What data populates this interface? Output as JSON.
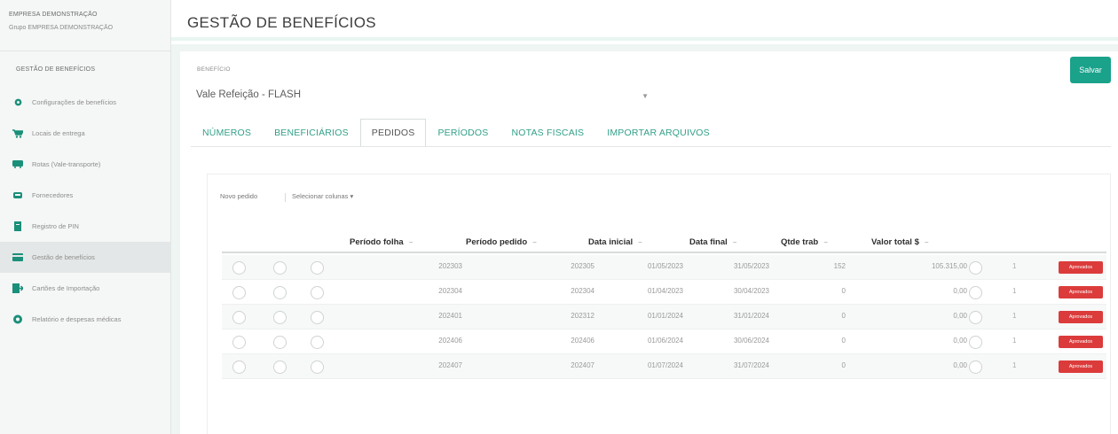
{
  "sidebar": {
    "company": "EMPRESA DEMONSTRAÇÃO",
    "group": "Grupo EMPRESA DEMONSTRAÇÃO",
    "section": "GESTÃO DE BENEFÍCIOS",
    "items": [
      {
        "label": "Configurações de benefícios",
        "icon": "gear-icon",
        "color": "#1a8f79"
      },
      {
        "label": "Locais de entrega",
        "icon": "cart-icon",
        "color": "#1a8f79"
      },
      {
        "label": "Rotas (Vale-transporte)",
        "icon": "bus-icon",
        "color": "#1a8f79"
      },
      {
        "label": "Fornecedores",
        "icon": "car-icon",
        "color": "#1a8f79"
      },
      {
        "label": "Registro de PIN",
        "icon": "document-icon",
        "color": "#1a8f79"
      },
      {
        "label": "Gestão de benefícios",
        "icon": "card-icon",
        "color": "#1a8f79"
      },
      {
        "label": "Cartões de Importação",
        "icon": "file-import-icon",
        "color": "#1a8f79"
      },
      {
        "label": "Relatório e despesas médicas",
        "icon": "stethoscope-icon",
        "color": "#1a8f79"
      }
    ],
    "active_index": 5
  },
  "header": {
    "title": "GESTÃO DE BENEFÍCIOS"
  },
  "form": {
    "benefit_label": "BENEFÍCIO",
    "benefit_value": "Vale Refeição - FLASH",
    "save_label": "Salvar"
  },
  "tabs": [
    {
      "label": "NÚMEROS",
      "active": false
    },
    {
      "label": "BENEFICIÁRIOS",
      "active": false
    },
    {
      "label": "PEDIDOS",
      "active": true
    },
    {
      "label": "PERÍODOS",
      "active": false
    },
    {
      "label": "NOTAS FISCAIS",
      "active": false
    },
    {
      "label": "IMPORTAR ARQUIVOS",
      "active": false
    }
  ],
  "toolbar": {
    "new_order": "Novo pedido",
    "select_columns": "Selecionar colunas"
  },
  "table": {
    "columns": [
      "Período folha",
      "Período pedido",
      "Data inicial",
      "Data final",
      "Qtde trab",
      "Valor total $"
    ],
    "rows": [
      {
        "periodo_folha": "202303",
        "periodo_pedido": "202305",
        "data_inicial": "01/05/2023",
        "data_final": "31/05/2023",
        "qtde_trab": "152",
        "valor_total": "105.315,00",
        "pin": "1",
        "status": "Aprovados"
      },
      {
        "periodo_folha": "202304",
        "periodo_pedido": "202304",
        "data_inicial": "01/04/2023",
        "data_final": "30/04/2023",
        "qtde_trab": "0",
        "valor_total": "0,00",
        "pin": "1",
        "status": "Aprovados"
      },
      {
        "periodo_folha": "202401",
        "periodo_pedido": "202312",
        "data_inicial": "01/01/2024",
        "data_final": "31/01/2024",
        "qtde_trab": "0",
        "valor_total": "0,00",
        "pin": "1",
        "status": "Aprovados"
      },
      {
        "periodo_folha": "202406",
        "periodo_pedido": "202406",
        "data_inicial": "01/06/2024",
        "data_final": "30/06/2024",
        "qtde_trab": "0",
        "valor_total": "0,00",
        "pin": "1",
        "status": "Aprovados"
      },
      {
        "periodo_folha": "202407",
        "periodo_pedido": "202407",
        "data_inicial": "01/07/2024",
        "data_final": "31/07/2024",
        "qtde_trab": "0",
        "valor_total": "0,00",
        "pin": "1",
        "status": "Aprovados"
      }
    ]
  },
  "colors": {
    "accent": "#1aa28b",
    "badge": "#dc3b3b"
  }
}
